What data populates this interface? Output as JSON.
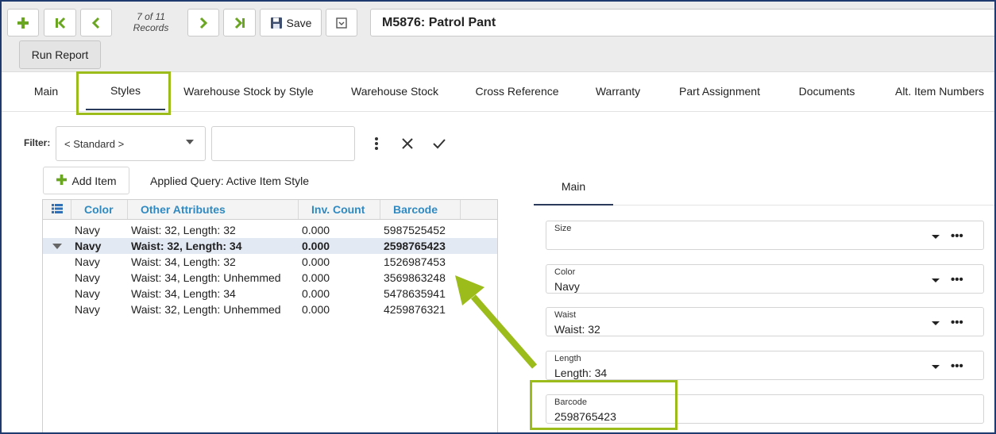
{
  "toolbar": {
    "record_counter": "7 of 11",
    "records_label": "Records",
    "save_label": "Save",
    "title": "M5876: Patrol Pant",
    "run_report_label": "Run Report"
  },
  "tabs": [
    "Main",
    "Styles",
    "Warehouse Stock by Style",
    "Warehouse Stock",
    "Cross Reference",
    "Warranty",
    "Part Assignment",
    "Documents",
    "Alt. Item Numbers"
  ],
  "active_tab": "Styles",
  "filter": {
    "label": "Filter:",
    "selected": "< Standard >",
    "search_value": ""
  },
  "add_item_label": "Add Item",
  "applied_query": "Applied Query: Active Item Style",
  "grid": {
    "columns": [
      "Color",
      "Other Attributes",
      "Inv. Count",
      "Barcode"
    ],
    "rows": [
      {
        "color": "Navy",
        "attributes": "Waist: 32, Length: 32",
        "count": "0.000",
        "barcode": "5987525452"
      },
      {
        "color": "Navy",
        "attributes": "Waist: 32, Length: 34",
        "count": "0.000",
        "barcode": "2598765423"
      },
      {
        "color": "Navy",
        "attributes": "Waist: 34, Length: 32",
        "count": "0.000",
        "barcode": "1526987453"
      },
      {
        "color": "Navy",
        "attributes": "Waist: 34, Length: Unhemmed",
        "count": "0.000",
        "barcode": "3569863248"
      },
      {
        "color": "Navy",
        "attributes": "Waist: 34, Length: 34",
        "count": "0.000",
        "barcode": "5478635941"
      },
      {
        "color": "Navy",
        "attributes": "Waist: 32, Length: Unhemmed",
        "count": "0.000",
        "barcode": "4259876321"
      }
    ],
    "selected_row": 2
  },
  "detail": {
    "tab": "Main",
    "fields": [
      {
        "label": "Size",
        "value": ""
      },
      {
        "label": "Color",
        "value": "Navy"
      },
      {
        "label": "Waist",
        "value": "Waist: 32"
      },
      {
        "label": "Length",
        "value": "Length: 34"
      },
      {
        "label": "Barcode",
        "value": "2598765423"
      }
    ]
  },
  "colors": {
    "accent_green": "#6aa621",
    "highlight": "#9cbc1b",
    "header_text": "#2f8ac2",
    "border": "#1e3a6e"
  },
  "icons": [
    "add-icon",
    "first-record-icon",
    "previous-icon",
    "next-icon",
    "last-record-icon",
    "save-icon",
    "archive-icon",
    "more-vertical-icon",
    "close-icon",
    "check-icon",
    "column-chooser-icon",
    "more-horizontal-icon",
    "dropdown-caret-icon"
  ]
}
